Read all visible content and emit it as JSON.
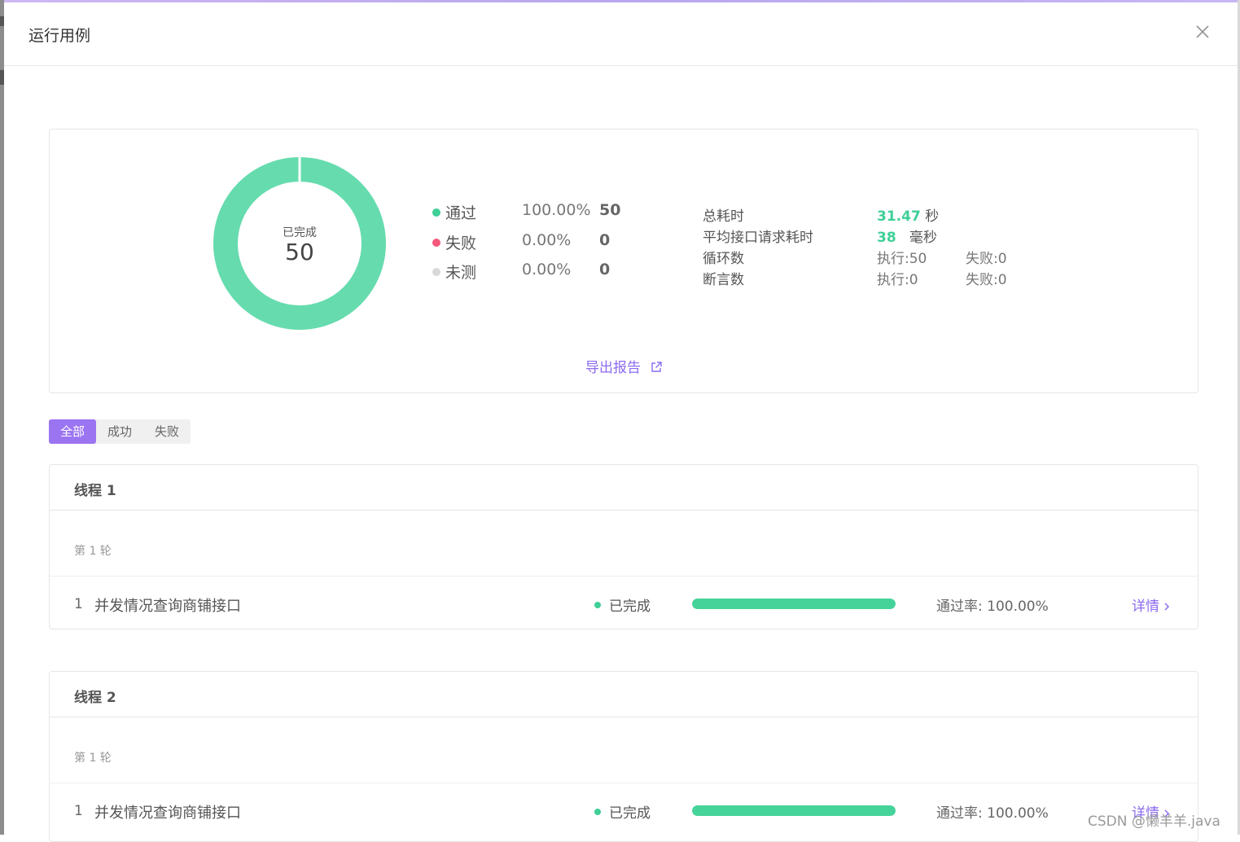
{
  "dialog": {
    "title": "运行用例"
  },
  "summary": {
    "donut_label": "已完成",
    "donut_value": "50",
    "pass_fraction": 1.0,
    "colors": {
      "pass": "#66dcae",
      "fail": "#f05a7a",
      "untested": "#d9d9d9"
    },
    "legend": [
      {
        "name": "通过",
        "percent": "100.00%",
        "count": "50",
        "color": "#3fcf97"
      },
      {
        "name": "失败",
        "percent": "0.00%",
        "count": "0",
        "color": "#f5597b"
      },
      {
        "name": "未测",
        "percent": "0.00%",
        "count": "0",
        "color": "#d9d9d9"
      }
    ],
    "stats": {
      "total_time_label": "总耗时",
      "total_time_value": "31.47",
      "total_time_unit": "秒",
      "avg_time_label": "平均接口请求耗时",
      "avg_time_value": "38",
      "avg_time_unit": "毫秒",
      "loops_label": "循环数",
      "loops_exec": "执行:50",
      "loops_fail": "失败:0",
      "asserts_label": "断言数",
      "asserts_exec": "执行:0",
      "asserts_fail": "失败:0"
    },
    "export_label": "导出报告"
  },
  "filters": [
    {
      "label": "全部",
      "active": true
    },
    {
      "label": "成功",
      "active": false
    },
    {
      "label": "失败",
      "active": false
    }
  ],
  "threads": [
    {
      "title": "线程 1",
      "round": "第 1 轮",
      "case": {
        "index": "1",
        "name": "并发情况查询商铺接口",
        "status": "已完成",
        "progress": 1.0,
        "rate": "通过率: 100.00%",
        "detail": "详情"
      }
    },
    {
      "title": "线程 2",
      "round": "第 1 轮",
      "case": {
        "index": "1",
        "name": "并发情况查询商铺接口",
        "status": "已完成",
        "progress": 1.0,
        "rate": "通过率: 100.00%",
        "detail": "详情"
      }
    }
  ],
  "watermark": "CSDN @懒羊羊.java"
}
